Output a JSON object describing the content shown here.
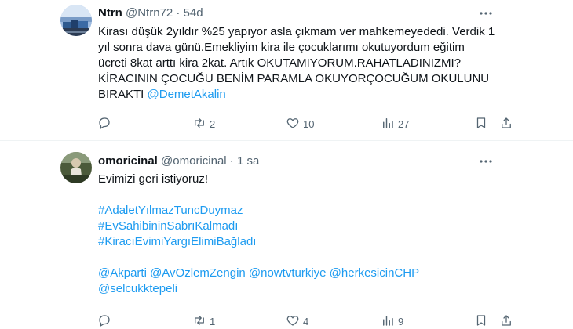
{
  "tweets": [
    {
      "name": "Ntrn",
      "handle": "@Ntrn72",
      "separator": "·",
      "time": "54d",
      "lines": [
        "Kirası düşük 2yıldır %25 yapıyor asla çıkmam ver mahkemeyededi. Verdik 1",
        "yıl sonra dava günü.Emekliyim kira ile çocuklarımı okutuyordum eğitim",
        "ücreti 8kat arttı kira 2kat. Artık OKUTAMIYORUM.RAHATLADINIZMI?",
        "KİRACININ ÇOCUĞU BENİM PARAMLA OKUYORÇOCUĞUM OKULUNU"
      ],
      "last_line_text": "BIRAKTI ",
      "last_line_link": "@DemetAkalin",
      "actions": {
        "replies": "",
        "reposts": "2",
        "likes": "10",
        "views": "27"
      }
    },
    {
      "name": "omoricinal",
      "handle": "@omoricinal",
      "separator": "·",
      "time": "1 sa",
      "text": "Evimizi geri istiyoruz!",
      "hashtags": [
        "#AdaletYılmazTuncDuymaz",
        "#EvSahibininSabrıKalmadı",
        "#KiracıEvimiYargıElimiBağladı"
      ],
      "mentions_line1": "@Akparti @AvOzlemZengin @nowtvturkiye @herkesicinCHP",
      "mentions_line2": "@selcukktepeli",
      "actions": {
        "replies": "",
        "reposts": "1",
        "likes": "4",
        "views": "9"
      }
    }
  ],
  "icons": {
    "reply": "reply-icon",
    "repost": "repost-icon",
    "like": "heart-icon",
    "views": "views-icon",
    "bookmark": "bookmark-icon",
    "share": "share-icon",
    "more": "more-icon"
  },
  "colors": {
    "link": "#1d9bf0",
    "muted": "#536471",
    "text": "#0f1419",
    "divider": "#eff3f4"
  }
}
